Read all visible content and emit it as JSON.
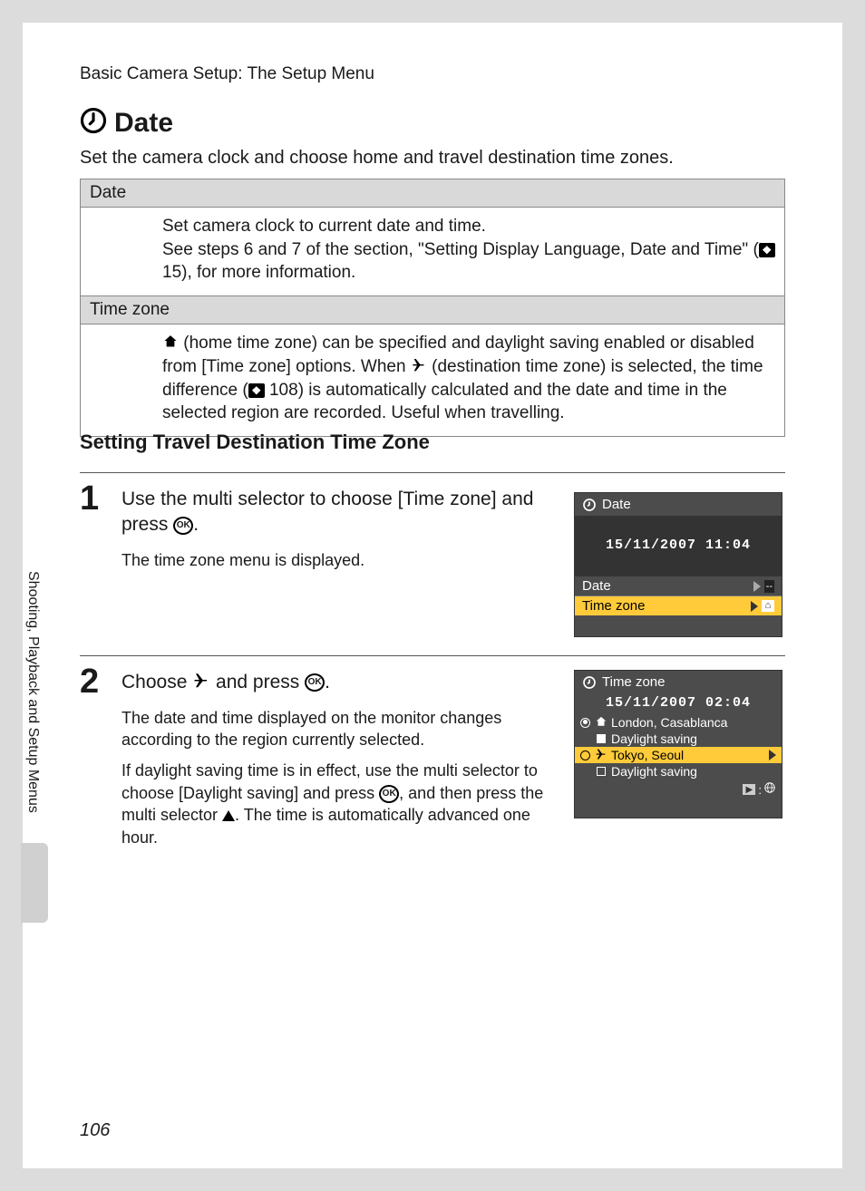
{
  "header": "Basic Camera Setup: The Setup Menu",
  "heading": "Date",
  "intro": "Set the camera clock and choose home and travel destination time zones.",
  "table": {
    "row1_header": "Date",
    "row1_body_a": "Set camera clock to current date and time.",
    "row1_body_b1": "See steps 6 and 7 of the section, \"Setting Display Language, Date and Time\" (",
    "row1_body_b_ref": "15",
    "row1_body_b2": "), for more information.",
    "row2_header": "Time zone",
    "row2_body_a": " (home time zone) can be specified and daylight saving enabled or disabled from [Time zone] options. When ",
    "row2_body_b": " (destination time zone) is selected, the time difference (",
    "row2_body_ref": "108",
    "row2_body_c": ") is automatically calculated and the date and time in the selected region are recorded. Useful when travelling."
  },
  "subheading": "Setting Travel Destination Time Zone",
  "step1": {
    "num": "1",
    "title_a": "Use the multi selector to choose [Time zone] and press ",
    "title_b": ".",
    "desc": "The time zone menu is displayed."
  },
  "step2": {
    "num": "2",
    "title_a": "Choose ",
    "title_b": " and press ",
    "title_c": ".",
    "desc1": "The date and time displayed on the monitor changes according to the region currently selected.",
    "desc2a": "If daylight saving time is in effect, use the multi selector to choose [Daylight saving] and press ",
    "desc2b": ", and then press the multi selector ",
    "desc2c": ". The time is automatically advanced one hour."
  },
  "lcd1": {
    "title": "Date",
    "datetime": "15/11/2007  11:04",
    "opt1": "Date",
    "opt2": "Time zone"
  },
  "lcd2": {
    "title": "Time zone",
    "datetime": "15/11/2007    02:04",
    "home": "London, Casablanca",
    "ds1": "Daylight saving",
    "dest": "Tokyo, Seoul",
    "ds2": "Daylight saving"
  },
  "side_tab": "Shooting, Playback and Setup Menus",
  "page_number": "106",
  "ok_label": "OK"
}
